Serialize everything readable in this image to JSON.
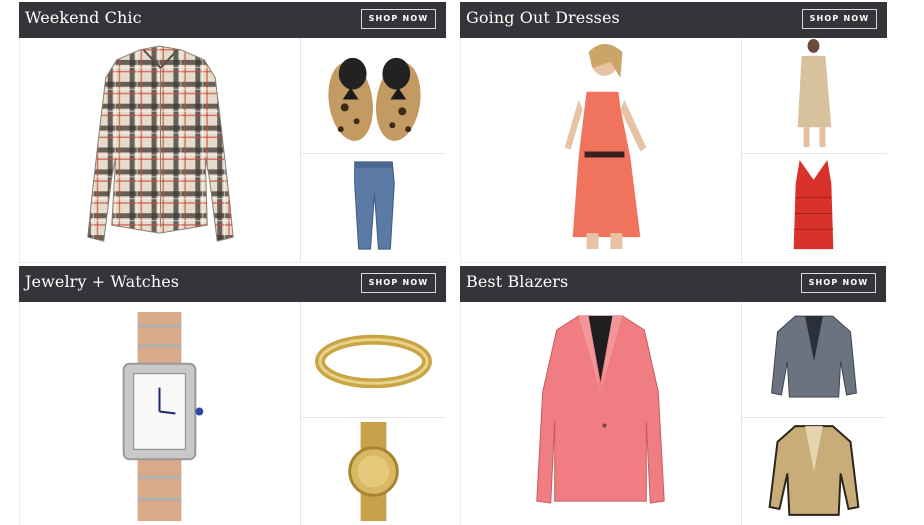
{
  "panels": [
    {
      "title": "Weekend Chic",
      "button": "SHOP NOW",
      "images": [
        "plaid-shirt",
        "leopard-loafers",
        "jeans"
      ]
    },
    {
      "title": "Going Out Dresses",
      "button": "SHOP NOW",
      "images": [
        "coral-dress-model",
        "beige-lace-dress",
        "red-bandage-dress"
      ]
    },
    {
      "title": "Jewelry + Watches",
      "button": "SHOP NOW",
      "images": [
        "two-tone-watch",
        "gold-bangle",
        "gold-watch"
      ]
    },
    {
      "title": "Best Blazers",
      "button": "SHOP NOW",
      "images": [
        "pink-blazer",
        "tweed-jacket",
        "tan-blazer"
      ]
    }
  ],
  "colors": {
    "header_bg": "#333538",
    "header_text": "#ffffff",
    "page_bg": "#ffffff"
  }
}
